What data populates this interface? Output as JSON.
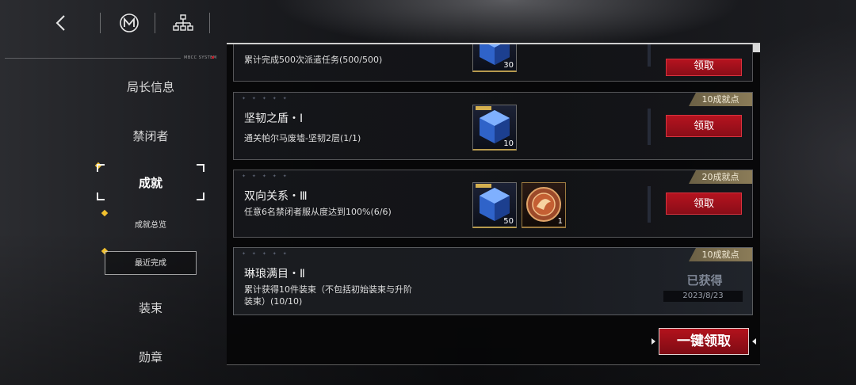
{
  "topbar": {
    "back_icon": "chevron-left-icon",
    "logo_icon": "m-emblem-icon",
    "tree_icon": "hierarchy-icon"
  },
  "system_label": "MBCC SYSTEM",
  "nav": {
    "items": [
      "局长信息",
      "禁闭者",
      "成就",
      "装束",
      "勋章"
    ],
    "active": "成就",
    "sub_items": [
      "成就总览",
      "最近完成"
    ],
    "selected_sub": "最近完成"
  },
  "panel": {
    "tag": "MBCC",
    "cards": [
      {
        "title": "",
        "desc": "累计完成500次派遣任务(500/500)",
        "points": "",
        "rewards": [
          {
            "icon": "blue-cube-icon",
            "qty": "30"
          }
        ],
        "action": "领取",
        "status": "claimable"
      },
      {
        "title": "坚韧之盾・Ⅰ",
        "desc": "通关帕尔马废墟-坚韧2层(1/1)",
        "points": "10成就点",
        "rewards": [
          {
            "icon": "blue-cube-icon",
            "qty": "10"
          }
        ],
        "action": "领取",
        "status": "claimable"
      },
      {
        "title": "双向关系・Ⅲ",
        "desc": "任意6名禁闭者服从度达到100%(6/6)",
        "points": "20成就点",
        "rewards": [
          {
            "icon": "blue-cube-icon",
            "qty": "50"
          },
          {
            "icon": "bronze-medal-icon",
            "qty": "1"
          }
        ],
        "action": "领取",
        "status": "claimable"
      },
      {
        "title": "琳琅满目・Ⅱ",
        "desc": "累计获得10件装束（不包括初始装束与升阶装束）(10/10)",
        "points": "10成就点",
        "rewards": [],
        "action": "已获得",
        "date": "2023/8/23",
        "status": "obtained"
      }
    ],
    "claim_all": "一键领取"
  },
  "colors": {
    "accent_red": "#b3121c",
    "gold": "#f2c12e",
    "points_tag": "#8b7c58"
  }
}
